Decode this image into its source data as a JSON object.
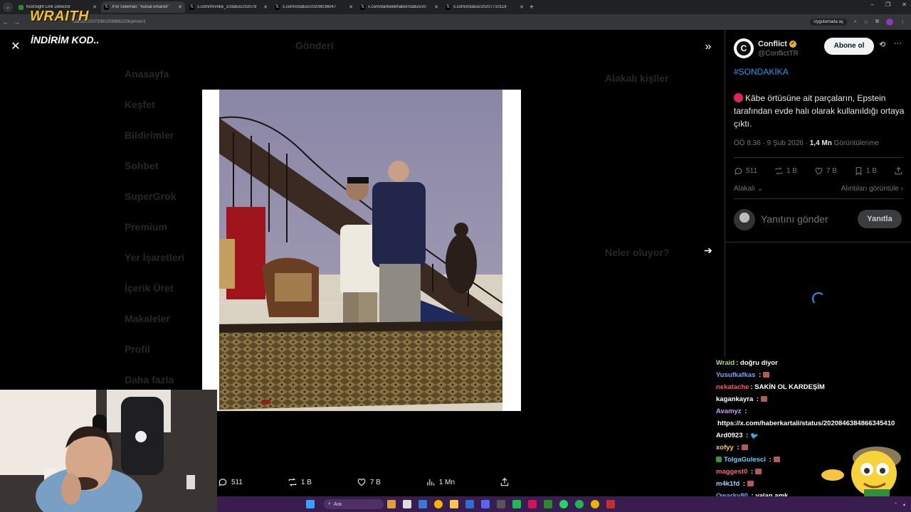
{
  "browser": {
    "tabs": [
      {
        "title": "KickSight Link Detector",
        "active": false,
        "fav": "#2a8a3a"
      },
      {
        "title": "X'te Süleman: \"kutsal emanet\"",
        "active": true,
        "fav": "#000000"
      },
      {
        "title": "x.com/mrvnke_1/status/202079",
        "active": false,
        "fav": "#000000"
      },
      {
        "title": "x.com/i/status/20208036047",
        "active": false,
        "fav": "#000000"
      },
      {
        "title": "x.com/darkwebhaber/status/20",
        "active": false,
        "fav": "#000000"
      },
      {
        "title": "x.com/i/status/20207710119",
        "active": false,
        "fav": "#000000"
      }
    ],
    "url": "status/2020733602598662206/photo/1",
    "apps_label": "Uygulamada aç"
  },
  "overlay": {
    "brand": "WRAITH",
    "promo": "İNDİRİM KOD.."
  },
  "background_ui": {
    "title": "Gönderi",
    "nav": [
      "Anasayfa",
      "Keşfet",
      "Bildirimler",
      "Sohbet",
      "SuperGrok",
      "Premium",
      "Yer İşaretleri",
      "İçerik Üret",
      "Makaleler",
      "Profil",
      "Daha fazla"
    ],
    "related_heading": "Alakalı kişiler",
    "trends_heading": "Neler oluyor?"
  },
  "photo_actions": {
    "replies": "511",
    "reposts": "1 B",
    "likes": "7 B",
    "views": "1 Mn"
  },
  "tweet": {
    "author_name": "Conflict",
    "author_handle": "@ConflictTR",
    "avatar_letter": "C",
    "follow_label": "Abone ol",
    "hashtag": "#SONDAKİKA",
    "text": "Kâbe örtüsüne ait parçaların, Epstein tarafından evde halı olarak kullanıldığı ortaya çıktı.",
    "time": "ÖÖ 8:36 · 9 Şub 2026 · ",
    "views_count": "1,4 Mn",
    "views_label": " Görüntülenme",
    "replies": "511",
    "reposts": "1 B",
    "likes": "7 B",
    "bookmarks": "1 B",
    "related_label": "Alakalı",
    "quotes_label": "Alıntıları görüntüle",
    "reply_placeholder": "Yanıtını gönder",
    "reply_button": "Yanıtla"
  },
  "chat": [
    {
      "user": "Wraid",
      "color": "#9be07a",
      "msg": ": doğru diyor",
      "emote": false
    },
    {
      "user": "Yusufkafkas",
      "color": "#6fa8ff",
      "msg": " :",
      "emote": true
    },
    {
      "user": "nekatache",
      "color": "#ff5a5a",
      "msg": ": SAKİN OL KARDEŞİM",
      "emote": false
    },
    {
      "user": "kagankayra",
      "color": "#ffffff",
      "msg": " :",
      "emote": true
    },
    {
      "user": "Avamyz",
      "color": "#c8a0ff",
      "msg": " :",
      "emote": false
    },
    {
      "user": "",
      "color": "#ffffff",
      "msg": "https://x.com/haberkartali/status/2020846384866345410",
      "emote": false
    },
    {
      "user": "Ard0923",
      "color": "#ffffff",
      "msg": " :",
      "emote": false,
      "bird": true
    },
    {
      "user": "xofyy",
      "color": "#ffcc33",
      "msg": " :",
      "emote": true
    },
    {
      "user": "TolgaGulesci",
      "color": "#5fd3ff",
      "msg": " :",
      "emote": true,
      "badge": true
    },
    {
      "user": "maggest0",
      "color": "#ff5a8a",
      "msg": " :",
      "emote": true
    },
    {
      "user": "m4k1fd",
      "color": "#9ad0ff",
      "msg": " :",
      "emote": true
    },
    {
      "user": "Qwarky80",
      "color": "#6fa8ff",
      "msg": " : yalan amk",
      "emote": false
    }
  ],
  "taskbar": {
    "search_label": "Ara"
  },
  "icons": {
    "close": "close-icon",
    "collapse": "chevron-double-right-icon",
    "next": "arrow-right-icon"
  }
}
